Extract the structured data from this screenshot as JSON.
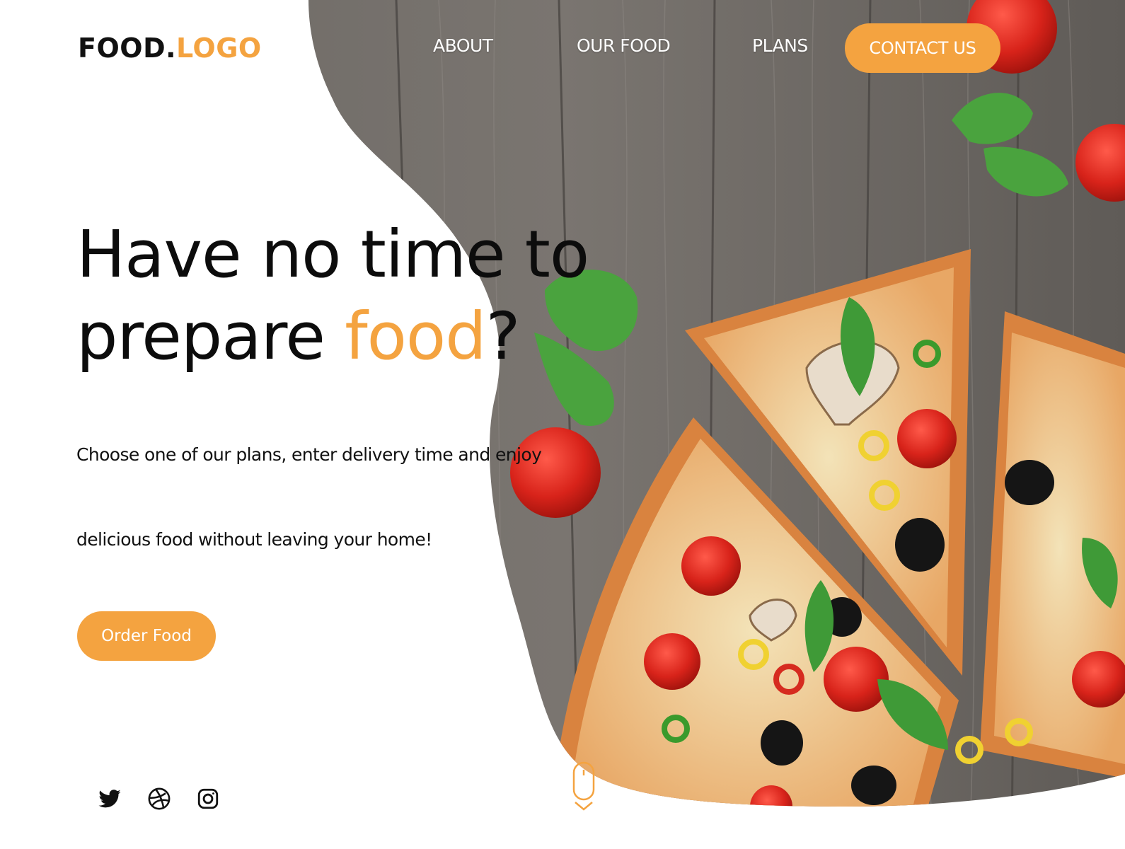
{
  "brand": {
    "logo_main": "FOOD.",
    "logo_accent": "LOGO"
  },
  "nav": {
    "items": [
      {
        "label": "ABOUT"
      },
      {
        "label": "OUR FOOD"
      },
      {
        "label": "PLANS"
      }
    ],
    "contact_label": "CONTACT US"
  },
  "hero": {
    "headline_part1": "Have no time to",
    "headline_part2": "prepare ",
    "headline_accent": "food",
    "headline_end": "?",
    "subtitle_line1": "Choose one of our plans, enter delivery time and enjoy",
    "subtitle_line2": "delicious food without leaving your home!",
    "cta_label": "Order Food"
  },
  "social": {
    "icons": [
      "twitter-icon",
      "dribbble-icon",
      "instagram-icon"
    ]
  },
  "colors": {
    "accent": "#f4a340",
    "text": "#111111",
    "background": "#ffffff"
  }
}
